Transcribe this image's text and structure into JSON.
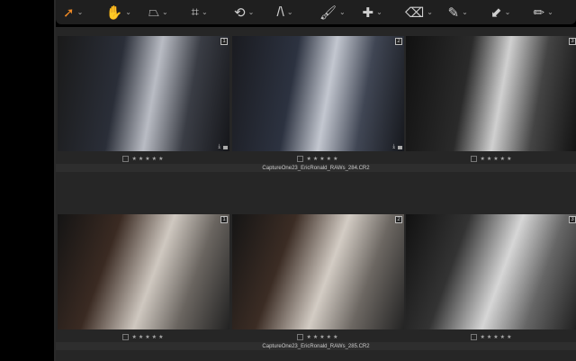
{
  "toolbar": {
    "tools": [
      {
        "name": "cursor-tool",
        "glyph": "➚"
      },
      {
        "name": "pan-tool",
        "glyph": "✋"
      },
      {
        "name": "keystone-tool",
        "glyph": "⏢"
      },
      {
        "name": "crop-tool",
        "glyph": "⌗"
      },
      {
        "name": "rotate-tool",
        "glyph": "⟲"
      },
      {
        "name": "guides-tool",
        "glyph": "/\\"
      },
      {
        "name": "brush-tool",
        "glyph": "🖌"
      },
      {
        "name": "heal-tool",
        "glyph": "✚"
      },
      {
        "name": "eraser-tool",
        "glyph": "⌫"
      },
      {
        "name": "picker-tool",
        "glyph": "✎"
      },
      {
        "name": "arrow-tool",
        "glyph": "⬋"
      },
      {
        "name": "pencil-tool",
        "glyph": "✏"
      }
    ]
  },
  "rows": [
    {
      "filename": "CaptureOne23_EricRonald_RAWs_284.CR2",
      "variants": [
        {
          "num": "1",
          "stars": "★★★★★"
        },
        {
          "num": "2",
          "stars": "★★★★★"
        },
        {
          "num": "3",
          "stars": "★★★★★"
        }
      ]
    },
    {
      "filename": "CaptureOne23_EricRonald_RAWs_285.CR2",
      "variants": [
        {
          "num": "1",
          "stars": "★★★★★"
        },
        {
          "num": "2",
          "stars": "★★★★★"
        },
        {
          "num": "3",
          "stars": "★★★★★"
        }
      ]
    }
  ]
}
